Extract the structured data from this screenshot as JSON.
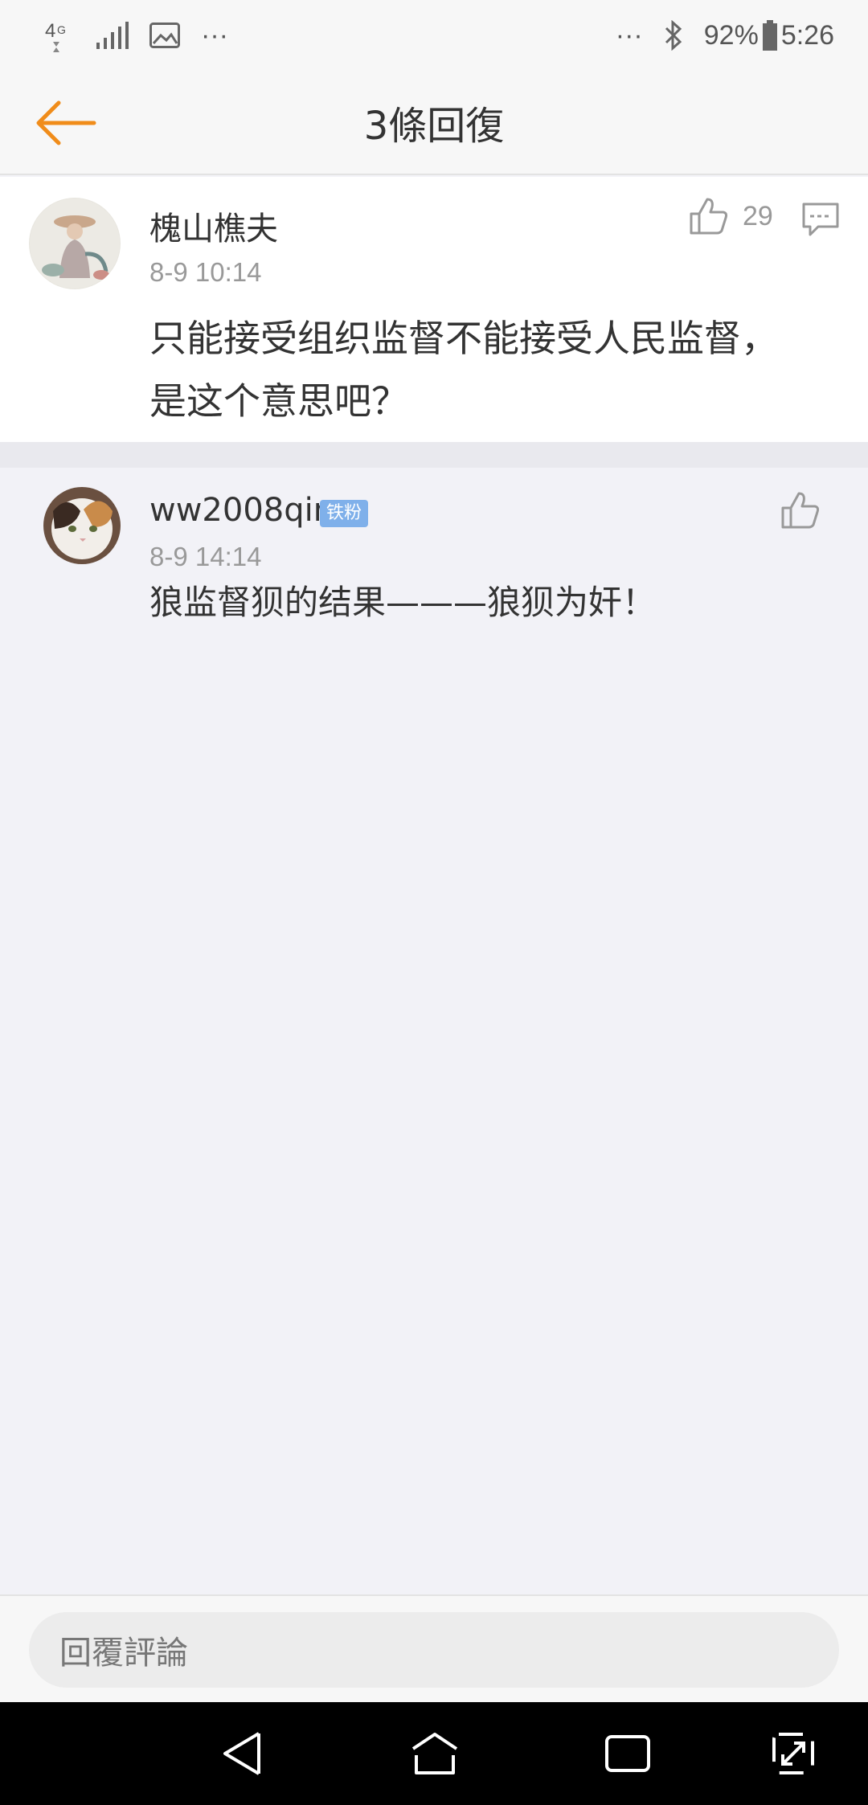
{
  "status_bar": {
    "network": "4G",
    "more_left": "···",
    "more_right": "···",
    "battery": "92%",
    "time": "5:26"
  },
  "header": {
    "title": "3條回復"
  },
  "main_comment": {
    "username": "槐山樵夫",
    "timestamp": "8-9 10:14",
    "like_count": "29",
    "content_line1": "只能接受组织监督不能接受人民监督，",
    "content_line2": "是这个意思吧？"
  },
  "replies": [
    {
      "username": "ww2008qin",
      "badge": "铁粉",
      "timestamp": "8-9 14:14",
      "content": "狼监督狈的结果———狼狈为奸！"
    }
  ],
  "reply_bar": {
    "placeholder": "回覆評論"
  },
  "colors": {
    "accent": "#f08c1a",
    "badge": "#7fb0ea",
    "background": "#f2f2f7"
  }
}
